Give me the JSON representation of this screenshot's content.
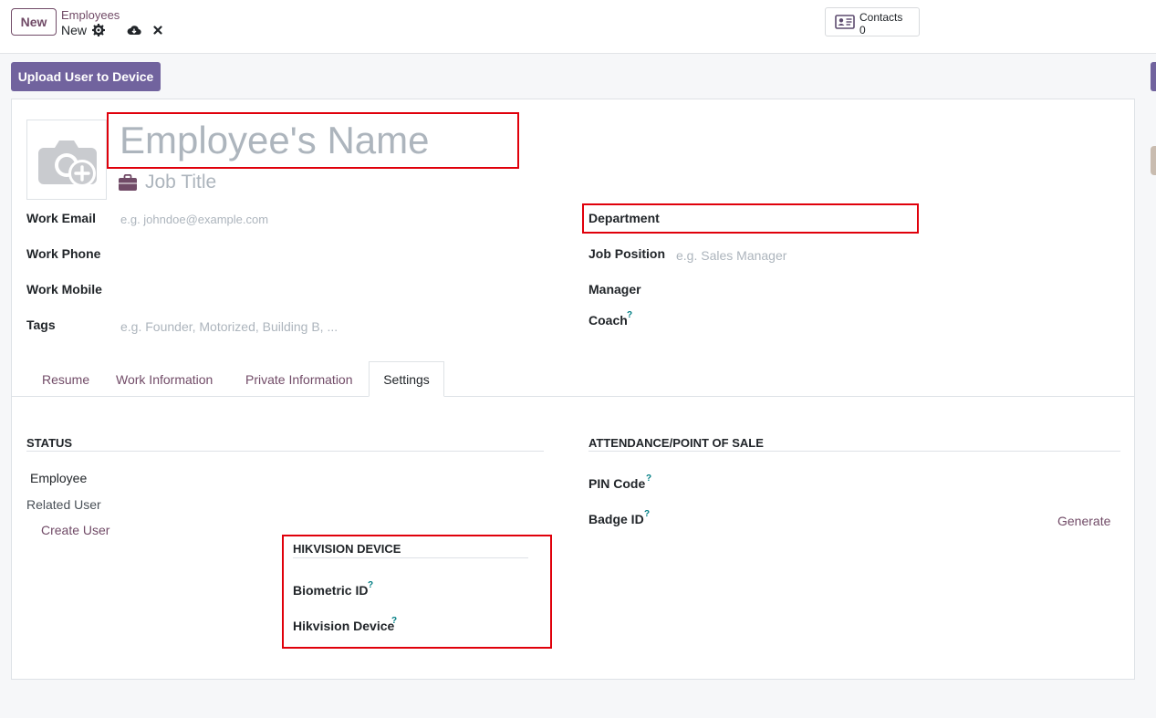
{
  "toolbar": {
    "new_label": "New",
    "breadcrumb_parent": "Employees",
    "breadcrumb_current": "New",
    "contacts_label": "Contacts",
    "contacts_count": "0"
  },
  "actions": {
    "upload_label": "Upload User to Device"
  },
  "header": {
    "name_placeholder": "Employee's Name",
    "job_title_placeholder": "Job Title"
  },
  "left_fields": {
    "work_email_label": "Work Email",
    "work_email_placeholder": "e.g. johndoe@example.com",
    "work_phone_label": "Work Phone",
    "work_mobile_label": "Work Mobile",
    "tags_label": "Tags",
    "tags_placeholder": "e.g. Founder, Motorized, Building B, ..."
  },
  "right_fields": {
    "department_label": "Department",
    "job_position_label": "Job Position",
    "job_position_placeholder": "e.g. Sales Manager",
    "manager_label": "Manager",
    "coach_label": "Coach"
  },
  "tabs": {
    "resume": "Resume",
    "work_information": "Work Information",
    "private_information": "Private Information",
    "settings": "Settings"
  },
  "status": {
    "title": "STATUS",
    "employee_label": "Employee",
    "related_user_label": "Related User",
    "create_user_label": "Create User"
  },
  "attendance": {
    "title": "ATTENDANCE/POINT OF SALE",
    "pin_code_label": "PIN Code",
    "badge_id_label": "Badge ID",
    "generate_label": "Generate"
  },
  "hikvision": {
    "title": "HIKVISION DEVICE",
    "biometric_id_label": "Biometric ID",
    "device_label": "Hikvision Device"
  },
  "help_mark": "?",
  "colors": {
    "brand": "#714b67",
    "primary_button": "#71639e",
    "highlight_border": "#e0000b",
    "help": "#017e84"
  }
}
